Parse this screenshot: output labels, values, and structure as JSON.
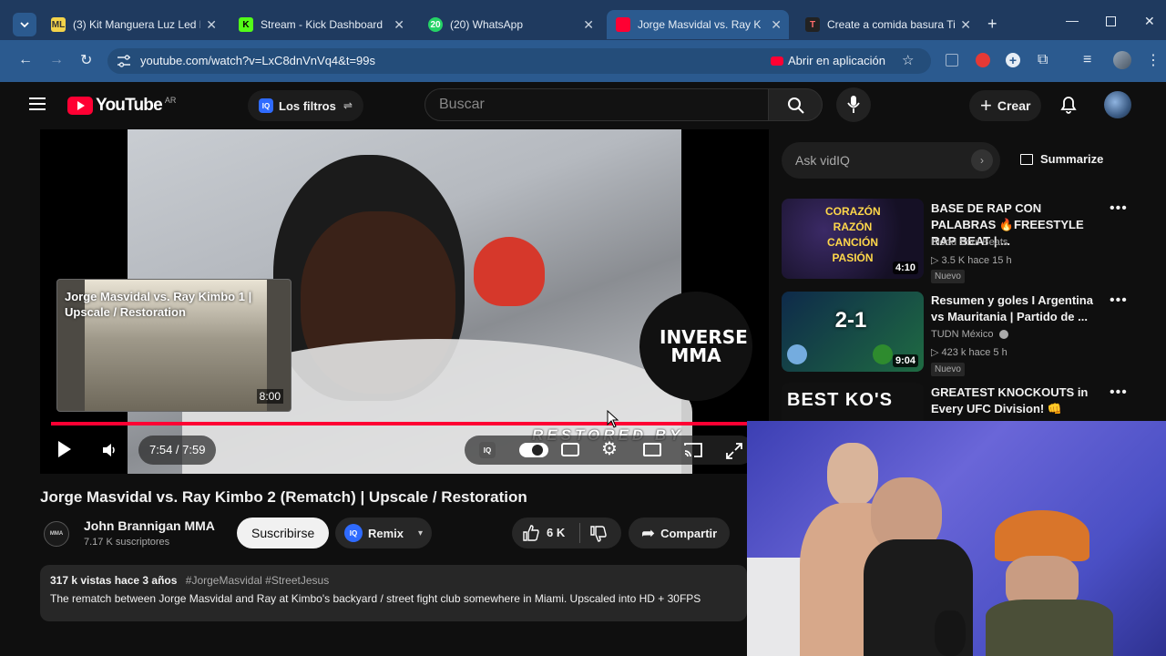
{
  "browser": {
    "tabs": [
      {
        "title": "(3) Kit Manguera Luz Led Ne",
        "favicon": "ML"
      },
      {
        "title": "Stream - Kick Dashboard",
        "favicon": "K"
      },
      {
        "title": "(20) WhatsApp",
        "favicon": "20"
      },
      {
        "title": "Jorge Masvidal vs. Ray Kimbo",
        "favicon": "YT"
      },
      {
        "title": "Create a comida basura Tier",
        "favicon": "T"
      }
    ],
    "url": "youtube.com/watch?v=LxC8dnVnVq4&t=99s",
    "open_in_app": "Abrir en aplicación"
  },
  "youtube": {
    "logo_text": "YouTube",
    "region": "AR",
    "filters_label": "Los filtros",
    "search_placeholder": "Buscar",
    "create_label": "Crear"
  },
  "player": {
    "time": "7:54 / 7:59",
    "progress_fraction": 0.988,
    "overlay_logo": "INVERSE MMA",
    "watermark": "RESTORED BY",
    "endcard": {
      "title": "Jorge Masvidal vs. Ray Kimbo 1 | Upscale / Restoration",
      "duration": "8:00"
    }
  },
  "video": {
    "title": "Jorge Masvidal vs. Ray Kimbo 2 (Rematch) | Upscale / Restoration",
    "channel": "John Brannigan MMA",
    "subscribers": "7.17 K suscriptores",
    "subscribe_label": "Suscribirse",
    "remix_label": "Remix",
    "likes": "6 K",
    "share_label": "Compartir",
    "stats": "317 k vistas  hace 3 años",
    "hashtags": "#JorgeMasvidal #StreetJesus",
    "description": "The rematch between Jorge Masvidal and Ray at Kimbo's backyard / street fight club somewhere in Miami. Upscaled into HD + 30FPS"
  },
  "sidebar": {
    "ask_placeholder": "Ask vidIQ",
    "summarize_label": "Summarize",
    "recs": [
      {
        "title": "BASE DE RAP CON PALABRAS 🔥FREESTYLE RAP BEAT | ...",
        "channel": "Blood Soul Beats",
        "meta": "▷ 3.5 K   hace 15 h",
        "badge": "Nuevo",
        "duration": "4:10",
        "thumb_text": "CORAZÓN RAZÓN CANCIÓN PASIÓN"
      },
      {
        "title": "Resumen y goles I Argentina vs Mauritania |  Partido de ...",
        "channel": "TUDN México",
        "meta": "▷ 423 k   hace 5 h",
        "badge": "Nuevo",
        "duration": "9:04",
        "thumb_text": "2-1"
      },
      {
        "title": "GREATEST KNOCKOUTS in Every UFC Division! 👊",
        "channel": "",
        "meta": "",
        "badge": "",
        "duration": "",
        "thumb_text": "BEST KO'S"
      }
    ]
  },
  "colors": {
    "tabbar": "#1f3a5f",
    "toolbar": "#2b5a8f",
    "yt_red": "#ff0033",
    "bg": "#0f0f0f"
  }
}
